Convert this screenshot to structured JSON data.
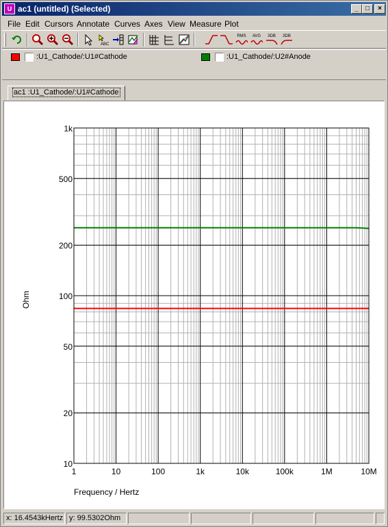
{
  "window": {
    "title": "ac1 (untitled) (Selected)",
    "app_icon_glyph": "U"
  },
  "menu": {
    "items": [
      "File",
      "Edit",
      "Cursors",
      "Annotate",
      "Curves",
      "Axes",
      "View",
      "Measure",
      "Plot"
    ]
  },
  "toolbar": {
    "buttons": [
      "undo-icon",
      "zoom-icon",
      "zoom-in-icon",
      "zoom-out-icon",
      "pointer-icon",
      "text-annotate-icon",
      "add-curve-icon",
      "curve-settings-icon",
      "x-axis-grid-icon",
      "y-axis-grid-icon",
      "axis-settings-icon",
      "rise-icon",
      "fall-icon",
      "rms-icon",
      "avg-icon",
      "3db-low-icon",
      "3db-high-icon"
    ],
    "labels": {
      "rms": "RMS",
      "avg": "AVG",
      "db1": "3DB",
      "db2": "3DB"
    }
  },
  "legend": {
    "curves": [
      {
        "label": ":U1_Cathode/:U1#Cathode",
        "color": "#ff0000"
      },
      {
        "label": ":U1_Cathode/:U2#Anode",
        "color": "#008000"
      }
    ]
  },
  "tab": {
    "label": "ac1 :U1_Cathode/:U1#Cathode"
  },
  "status": {
    "x": "x: 16.4543kHertz",
    "y": "y: 99.5302Ohm"
  },
  "chart_data": {
    "type": "line",
    "xlabel": "Frequency / Hertz",
    "ylabel": "Ohm",
    "x_scale": "log",
    "y_scale": "log",
    "xlim": [
      1,
      10000000
    ],
    "ylim": [
      10,
      1000
    ],
    "x_ticks": [
      {
        "value": 1,
        "label": "1"
      },
      {
        "value": 10,
        "label": "10"
      },
      {
        "value": 100,
        "label": "100"
      },
      {
        "value": 1000,
        "label": "1k"
      },
      {
        "value": 10000,
        "label": "10k"
      },
      {
        "value": 100000,
        "label": "100k"
      },
      {
        "value": 1000000,
        "label": "1M"
      },
      {
        "value": 10000000,
        "label": "10M"
      }
    ],
    "y_ticks": [
      {
        "value": 10,
        "label": "10"
      },
      {
        "value": 20,
        "label": "20"
      },
      {
        "value": 50,
        "label": "50"
      },
      {
        "value": 100,
        "label": "100"
      },
      {
        "value": 200,
        "label": "200"
      },
      {
        "value": 500,
        "label": "500"
      },
      {
        "value": 1000,
        "label": "1k"
      }
    ],
    "grid": true,
    "series": [
      {
        "color": "#ff0000",
        "x": [
          1,
          10000000
        ],
        "y": [
          84,
          84
        ]
      },
      {
        "color": "#008000",
        "x": [
          1,
          5000000,
          10000000
        ],
        "y": [
          254,
          254,
          252
        ]
      }
    ]
  }
}
